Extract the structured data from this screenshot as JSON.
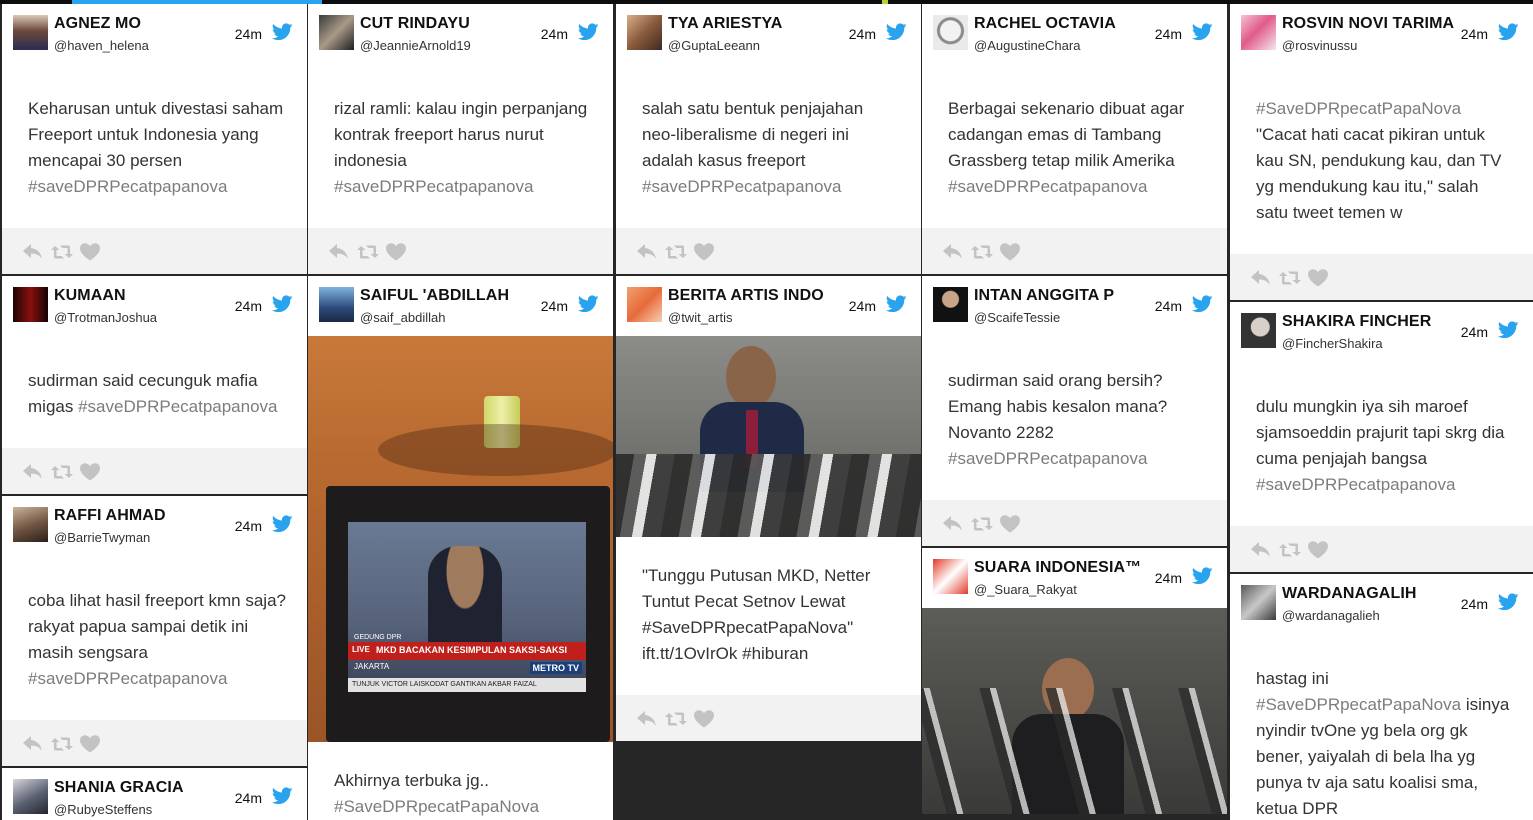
{
  "time_label": "24m",
  "columns": [
    {
      "tweets": [
        {
          "name": "AGNEZ MO",
          "handle": "@haven_helena",
          "text": "Keharusan untuk divestasi saham Freeport untuk Indonesia yang mencapai 30 persen",
          "tag": "#saveDPRPecatpapanova"
        },
        {
          "name": "KUMAAN",
          "handle": "@TrotmanJoshua",
          "text": "sudirman said cecunguk mafia migas",
          "tag": "#saveDPRPecatpapanova"
        },
        {
          "name": "RAFFI AHMAD",
          "handle": "@BarrieTwyman",
          "text": "coba lihat hasil freeport kmn saja? rakyat papua sampai detik ini masih sengsara",
          "tag": "#saveDPRPecatpapanova"
        },
        {
          "name": "SHANIA GRACIA",
          "handle": "@RubyeSteffens"
        }
      ]
    },
    {
      "tweets": [
        {
          "name": "CUT RINDAYU",
          "handle": "@JeannieArnold19",
          "text": "rizal ramli: kalau ingin perpanjang kontrak freeport harus nurut indonesia",
          "tag": "#saveDPRPecatpapanova"
        },
        {
          "name": "SAIFUL 'ABDILLAH",
          "handle": "@saif_abdillah",
          "text": "Akhirnya terbuka jg..",
          "tag": "#SaveDPRpecatPapaNova",
          "tv": {
            "caption": "MKD BACAKAN KESIMPULAN SAKSI-SAKSI",
            "live": "LIVE",
            "place": "JAKARTA",
            "channel": "METRO TV",
            "ticker": "TUNJUK VICTOR LAISKODAT GANTIKAN AKBAR FAIZAL",
            "top": "GEDUNG DPR"
          }
        }
      ]
    },
    {
      "tweets": [
        {
          "name": "TYA ARIESTYA",
          "handle": "@GuptaLeeann",
          "text": "salah satu bentuk penjajahan neo-liberalisme di negeri ini adalah kasus freeport",
          "tag": "#saveDPRPecatpapanova"
        },
        {
          "name": "BERITA ARTIS INDO",
          "handle": "@twit_artis",
          "text": "\"Tunggu Putusan MKD, Netter Tuntut Pecat Setnov Lewat #SaveDPRpecatPapaNova\" ift.tt/1OvIrOk #hiburan"
        }
      ]
    },
    {
      "tweets": [
        {
          "name": "RACHEL OCTAVIA",
          "handle": "@AugustineChara",
          "text": "Berbagai sekenario dibuat agar cadangan emas di Tambang Grassberg tetap milik Amerika",
          "tag": "#saveDPRPecatpapanova"
        },
        {
          "name": "INTAN ANGGITA P",
          "handle": "@ScaifeTessie",
          "text": "sudirman said orang bersih? Emang habis kesalon mana? Novanto 2282",
          "tag": "#saveDPRPecatpapanova"
        },
        {
          "name": "SUARA INDONESIA™",
          "handle": "@_Suara_Rakyat"
        }
      ]
    },
    {
      "tweets": [
        {
          "name": "ROSVIN NOVI TARIMA",
          "handle": "@rosvinussu",
          "tag": "#SaveDPRpecatPapaNova",
          "text": "\"Cacat hati cacat pikiran untuk kau SN, pendukung kau, dan TV yg mendukung kau itu,\" salah satu tweet temen w"
        },
        {
          "name": "SHAKIRA FINCHER",
          "handle": "@FincherShakira",
          "text": "dulu mungkin iya sih maroef sjamsoeddin prajurit tapi skrg dia cuma penjajah bangsa",
          "tag": "#saveDPRPecatpapanova"
        },
        {
          "name": "WARDANAGALIH",
          "handle": "@wardanagalieh",
          "text": "hastag ini",
          "tag": "#SaveDPRpecatPapaNova",
          "text2": "isinya nyindir tvOne yg bela org gk bener, yaiyalah di bela lha yg punya tv aja satu koalisi sma, ketua DPR"
        }
      ]
    }
  ]
}
